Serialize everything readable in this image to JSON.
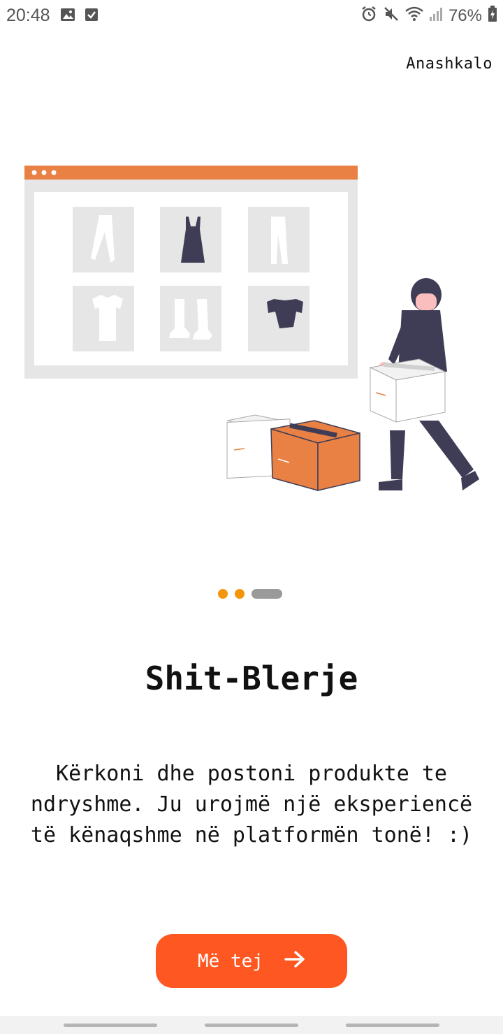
{
  "status_bar": {
    "time": "20:48",
    "battery": "76%",
    "icons": [
      "image-icon",
      "checkbox-icon",
      "alarm-icon",
      "mute-icon",
      "wifi-icon",
      "signal-icon",
      "battery-icon"
    ]
  },
  "skip_label": "Anashkalo",
  "pager": {
    "count": 3,
    "active_index": 2
  },
  "title": "Shit-Blerje",
  "description": "Kërkoni dhe postoni produkte te ndryshme. Ju urojmë një eksperiencë të kënaqshme në platformën tonë! :)",
  "next_button": {
    "label": "Më tej",
    "icon": "arrow-right-icon"
  },
  "colors": {
    "accent": "#ff5722",
    "dot": "#f5950c",
    "dot_active": "#9a9a9a",
    "illustration_orange": "#e98044",
    "illustration_dark": "#3f3d56"
  }
}
